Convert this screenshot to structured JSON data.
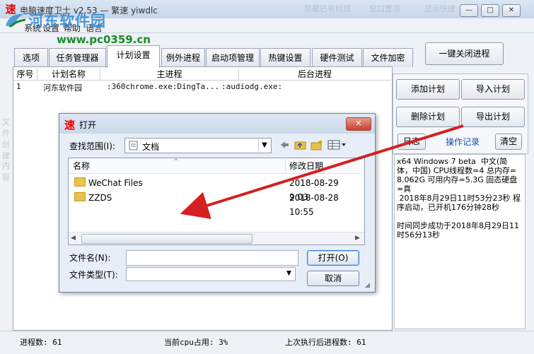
{
  "window": {
    "title": "电脑速度卫士 v2.53 — 繁速 yiwdlc",
    "faded_buttons": [
      "隐藏已有标题",
      "窗口置顶",
      "显示快捷"
    ],
    "controls": [
      "—",
      "□",
      "✕"
    ]
  },
  "watermark": {
    "name": "河东软件园",
    "url": "www.pc0359.cn"
  },
  "menu": [
    "系统",
    "设置",
    "帮助",
    "语言"
  ],
  "kill_all_button": "一键关闭进程",
  "tabs": [
    "选项",
    "任务管理器",
    "计划设置",
    "例外进程",
    "启动项管理",
    "热键设置",
    "硬件测试",
    "文件加密"
  ],
  "active_tab": 2,
  "ghost_labels": [
    "文件",
    "创建",
    "内容"
  ],
  "table": {
    "headers": [
      "序号",
      "计划名称",
      "主进程",
      "后台进程"
    ],
    "rows": [
      {
        "no": "1",
        "name": "河东软件园",
        "main": ":360chrome.exe:DingTa...",
        "bg": ":audiodg.exe:"
      }
    ]
  },
  "side_buttons": {
    "add_plan": "添加计划",
    "import_plan": "导入计划",
    "delete_plan": "删除计划",
    "export_plan": "导出计划",
    "log": "日志",
    "ops_label": "操作记录",
    "clear": "清空"
  },
  "log_text": "x64 Windows 7 beta  中文(简体，中国) CPU线程数=4 总内存=8.062G 可用内存=5.3G 固态硬盘=真\n 2018年8月29日11时53分23秒 程序启动，已开机176分钟28秒\n\n时间同步成功于2018年8月29日11时56分13秒",
  "status": {
    "process_count": "进程数: 61",
    "cpu": "当前cpu占用: 3%",
    "last_exec": "上次执行后进程数: 61"
  },
  "dialog": {
    "title": "打开",
    "look_in_label": "查找范围(I):",
    "look_in_value": "文档",
    "col_name": "名称",
    "col_date": "修改日期",
    "files": [
      {
        "name": "WeChat Files",
        "date": "2018-08-29 9:03"
      },
      {
        "name": "ZZDS",
        "date": "2018-08-28 10:55"
      }
    ],
    "filename_label": "文件名(N):",
    "filetype_label": "文件类型(T):",
    "filename_value": "",
    "filetype_value": "",
    "open_button": "打开(O)",
    "cancel_button": "取消"
  },
  "colors": {
    "accent_red": "#e00000",
    "arrow": "#d42020",
    "watermark_blue": "#2f86d4",
    "watermark_green": "#1c8a2a"
  }
}
